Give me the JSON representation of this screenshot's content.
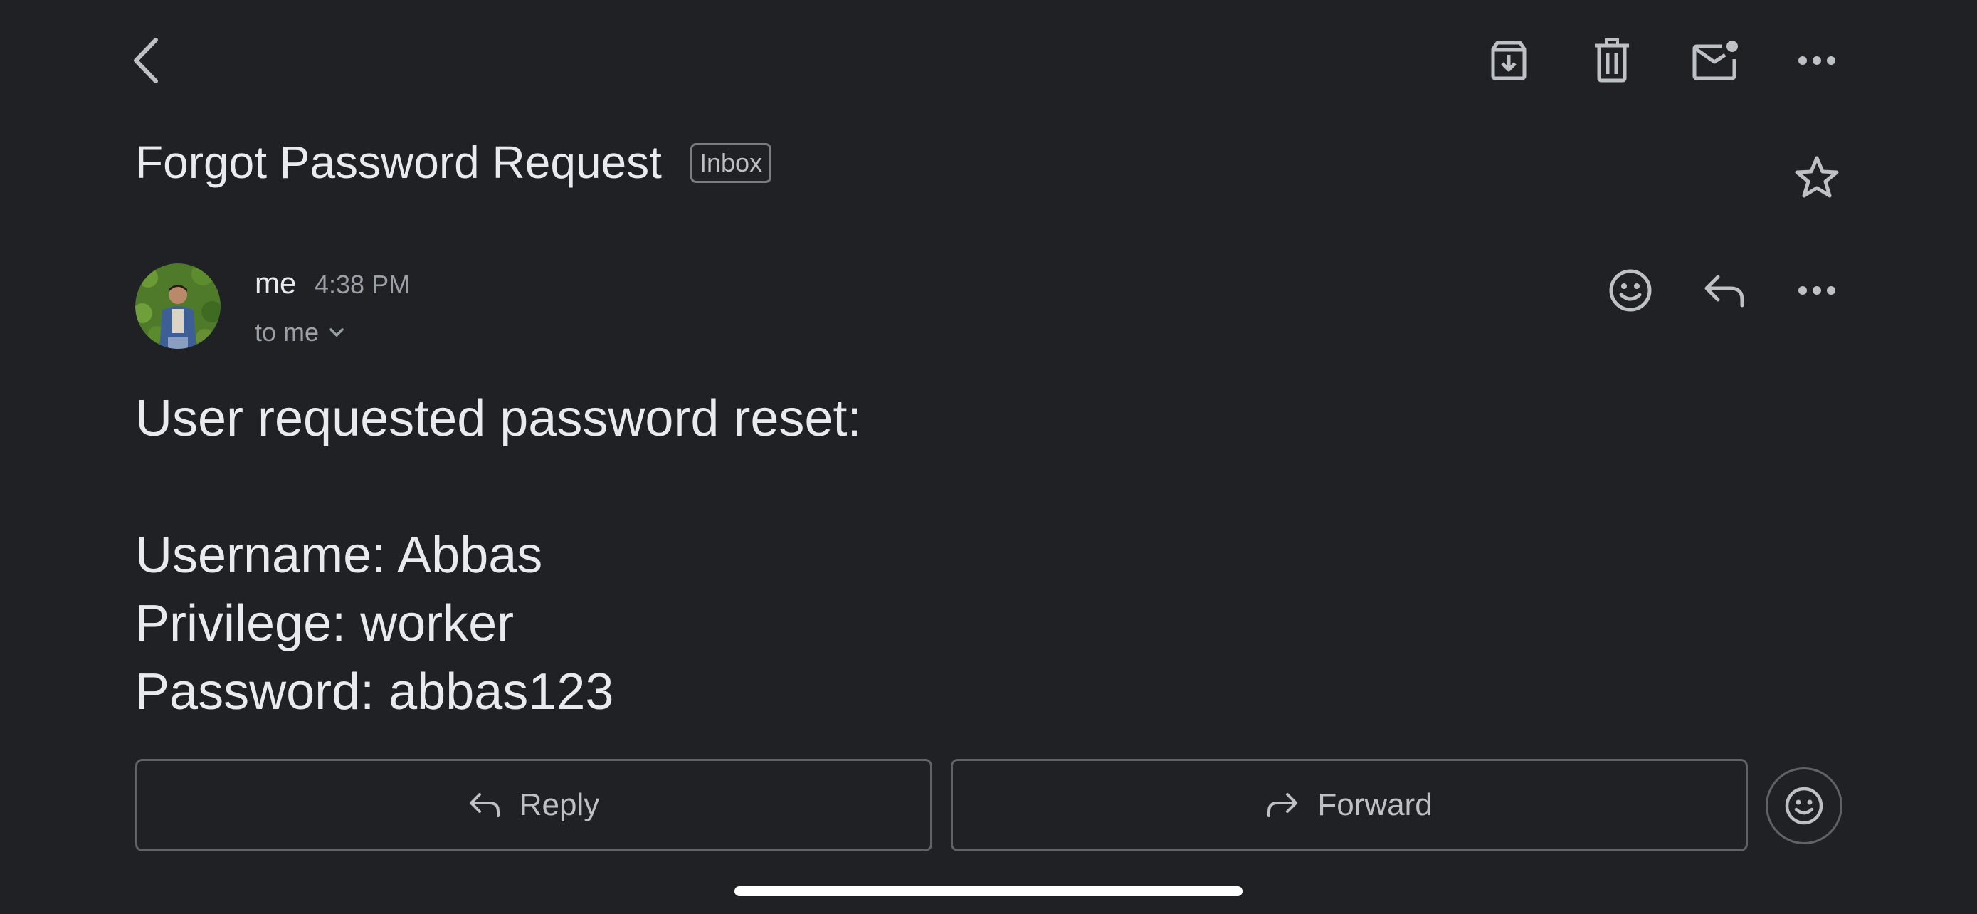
{
  "toolbar": {
    "back_icon": "chevron-left-icon",
    "archive_icon": "archive-icon",
    "delete_icon": "trash-icon",
    "unread_icon": "mark-unread-icon",
    "more_icon": "more-horizontal-icon"
  },
  "email": {
    "subject": "Forgot Password Request",
    "label": "Inbox",
    "starred": false,
    "sender": {
      "name": "me",
      "time": "4:38 PM",
      "recipient_summary": "to me"
    },
    "body_lines": [
      "User requested password reset:",
      "Username: Abbas",
      "Privilege: worker",
      "Password: abbas123"
    ]
  },
  "actions": {
    "reply_label": "Reply",
    "forward_label": "Forward"
  },
  "colors": {
    "background": "#202124",
    "text_primary": "#e8eaed",
    "text_secondary": "#9aa0a6",
    "icon": "#bdc1c6",
    "border": "#5f6368"
  }
}
